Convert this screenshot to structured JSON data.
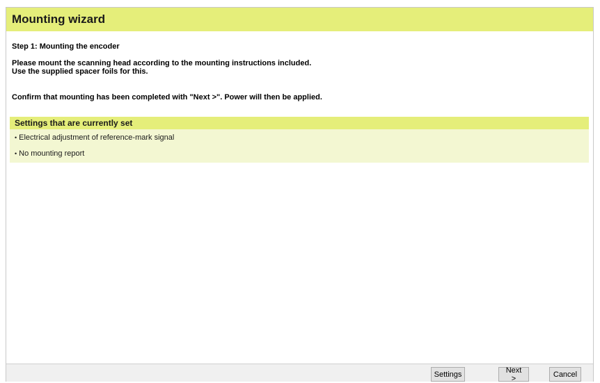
{
  "window": {
    "title": "Mounting wizard"
  },
  "step": {
    "title": "Step 1: Mounting the encoder",
    "instruction_line1": "Please mount the scanning head according to the mounting instructions included.",
    "instruction_line2": "Use the supplied spacer foils for this.",
    "confirm_text": "Confirm that mounting has been completed with \"Next >\". Power will then be applied."
  },
  "settings": {
    "header": "Settings that are currently set",
    "items": [
      {
        "bullet": "•",
        "label": "Electrical adjustment of reference-mark signal"
      },
      {
        "bullet": "•",
        "label": "No mounting report"
      }
    ]
  },
  "footer": {
    "settings_label": "Settings",
    "next_label": "Next >",
    "cancel_label": "Cancel"
  },
  "colors": {
    "accent": "#e5ee7a",
    "accent_light": "#f3f7d2",
    "footer_bg": "#f0f0f0"
  }
}
